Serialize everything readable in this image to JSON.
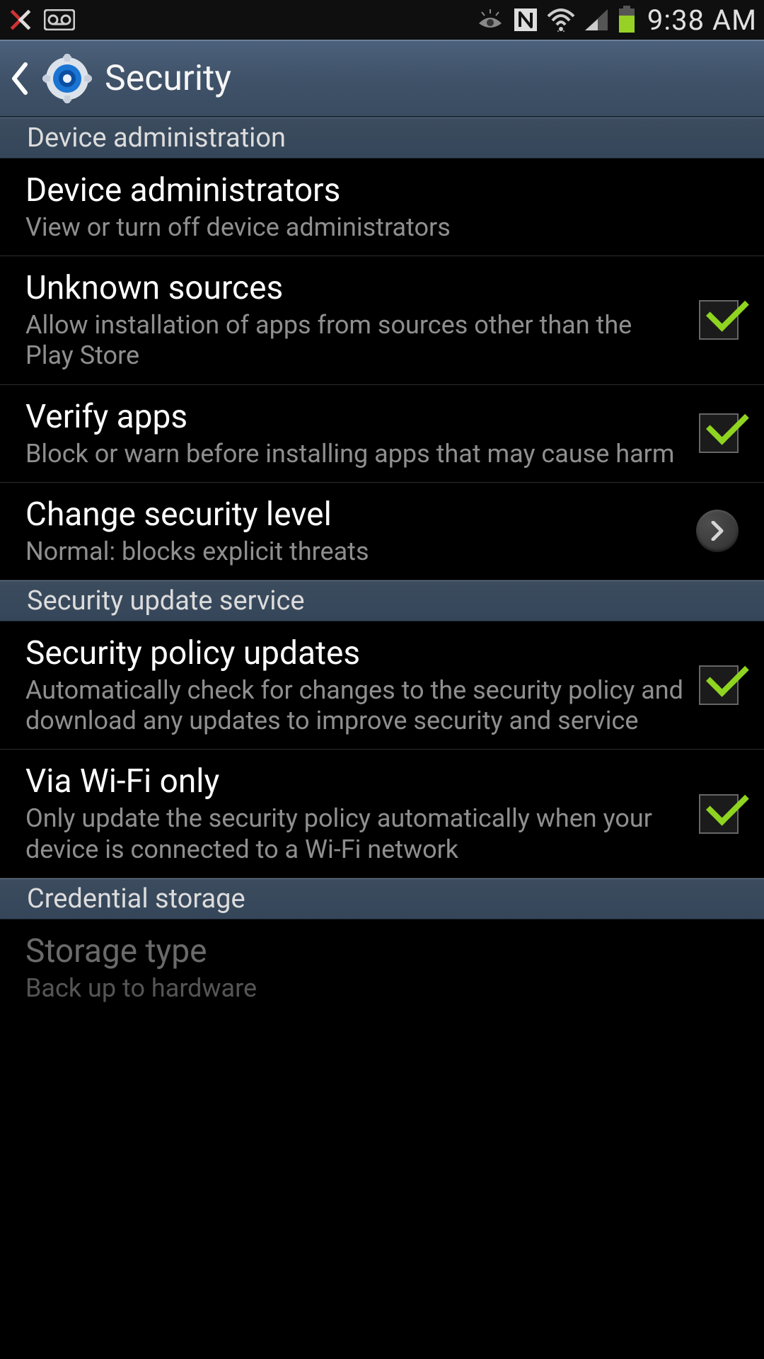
{
  "status": {
    "time": "9:38 AM"
  },
  "header": {
    "title": "Security"
  },
  "sections": {
    "device_admin": {
      "label": "Device administration",
      "items": {
        "device_admins": {
          "title": "Device administrators",
          "sub": "View or turn off device administrators"
        },
        "unknown_sources": {
          "title": "Unknown sources",
          "sub": "Allow installation of apps from sources other than the Play Store",
          "checked": true
        },
        "verify_apps": {
          "title": "Verify apps",
          "sub": "Block or warn before installing apps that may cause harm",
          "checked": true
        },
        "change_level": {
          "title": "Change security level",
          "sub": "Normal: blocks explicit threats"
        }
      }
    },
    "update_service": {
      "label": "Security update service",
      "items": {
        "policy_updates": {
          "title": "Security policy updates",
          "sub": "Automatically check for changes to the security policy and download any updates to improve security and service",
          "checked": true
        },
        "wifi_only": {
          "title": "Via Wi-Fi only",
          "sub": "Only update the security policy automatically when your device is connected to a Wi-Fi network",
          "checked": true
        }
      }
    },
    "cred_storage": {
      "label": "Credential storage",
      "items": {
        "storage_type": {
          "title": "Storage type",
          "sub": "Back up to hardware"
        }
      }
    }
  }
}
